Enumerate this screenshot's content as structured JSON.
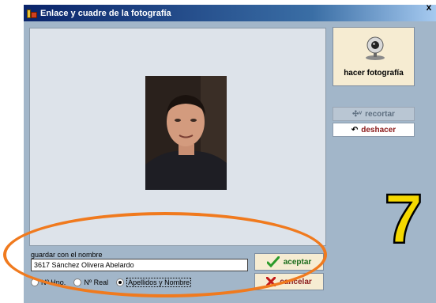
{
  "window": {
    "title": "Enlace y cuadre de la fotografía",
    "close_symbol": "x"
  },
  "toolbar": {
    "take_photo_label": "hacer fotografía",
    "crop_label": "recortar",
    "crop_icon_text": "✣ᵛ",
    "undo_label": "deshacer",
    "undo_icon_text": "↶"
  },
  "form": {
    "name_label": "guardar con el nombre",
    "name_value": "3617 Sánchez Olivera Abelardo",
    "radios": [
      {
        "label": "Nº Hno.",
        "checked": false
      },
      {
        "label": "Nº Real",
        "checked": false
      },
      {
        "label": "Apellidos y Nombre",
        "checked": true
      }
    ]
  },
  "actions": {
    "accept_label": "aceptar",
    "cancel_label": "cancelar"
  },
  "annotation": {
    "step_number": "7",
    "step_color": "#f5d800",
    "oval_color": "#f07a1e"
  }
}
